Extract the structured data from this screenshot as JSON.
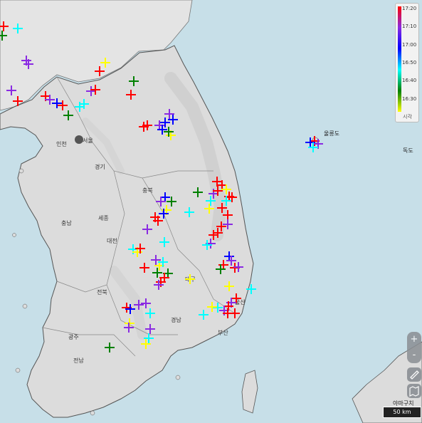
{
  "legend": {
    "ticks": [
      "17:20",
      "17:10",
      "17:00",
      "16:50",
      "16:40",
      "16:30"
    ],
    "caption": "시각",
    "colors": [
      "#ff0000",
      "#8a2be2",
      "#0000ff",
      "#00ffff",
      "#008000",
      "#ffff00"
    ]
  },
  "places": {
    "incheon": "인천",
    "seoul": "서울",
    "gyeonggi": "경기",
    "chungbuk": "충북",
    "chungnam": "충남",
    "sejong": "세종",
    "daejeon": "대전",
    "daegu": "대구",
    "jeonbuk": "전북",
    "gyeongnam": "경남",
    "busan": "부산",
    "ulsan": "울산",
    "gwangju": "광주",
    "jeonnam": "전남",
    "ulleungdo": "울릉도",
    "dokdo": "독도"
  },
  "controls": {
    "zoom_in": "+",
    "zoom_out": "-",
    "scale_name": "야마구치",
    "scale_label": "50 km"
  }
}
